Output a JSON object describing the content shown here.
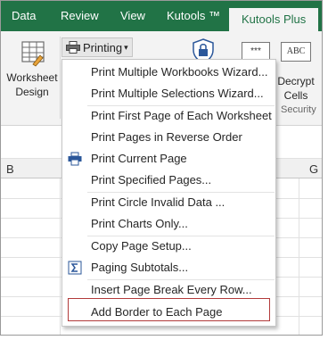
{
  "tabs": [
    {
      "label": "Data"
    },
    {
      "label": "Review"
    },
    {
      "label": "View"
    },
    {
      "label": "Kutools ™"
    },
    {
      "label": "Kutools Plus"
    }
  ],
  "ribbon": {
    "worksheet_design": {
      "line1": "Worksheet",
      "line2": "Design"
    },
    "printing": {
      "label": "Printing",
      "caret": "▾"
    },
    "encrypt_icon_text": "***",
    "abc_icon_text": "ABC",
    "decrypt": {
      "line1": "Decrypt",
      "line2": "Cells"
    },
    "security_group": "Security"
  },
  "sheet": {
    "columns": [
      "B",
      "G"
    ]
  },
  "menu": {
    "items": [
      {
        "label": "Print Multiple Workbooks Wizard...",
        "icon": ""
      },
      {
        "label": "Print Multiple Selections Wizard...",
        "icon": ""
      },
      {
        "label": "Print First Page of Each Worksheet",
        "icon": ""
      },
      {
        "label": "Print Pages in Reverse Order",
        "icon": ""
      },
      {
        "label": "Print Current Page",
        "icon": "printer-icon"
      },
      {
        "label": "Print Specified Pages...",
        "icon": ""
      },
      {
        "label": "Print Circle Invalid Data ...",
        "icon": ""
      },
      {
        "label": "Print Charts Only...",
        "icon": ""
      },
      {
        "label": "Copy Page Setup...",
        "icon": ""
      },
      {
        "label": "Paging Subtotals...",
        "icon": "sigma-icon"
      },
      {
        "label": "Insert Page Break Every Row...",
        "icon": ""
      },
      {
        "label": "Add Border to Each Page",
        "icon": ""
      }
    ],
    "highlighted_item": "Add Border to Each Page"
  },
  "colors": {
    "tab_bar": "#217346",
    "highlight_border": "#b23a3a"
  }
}
